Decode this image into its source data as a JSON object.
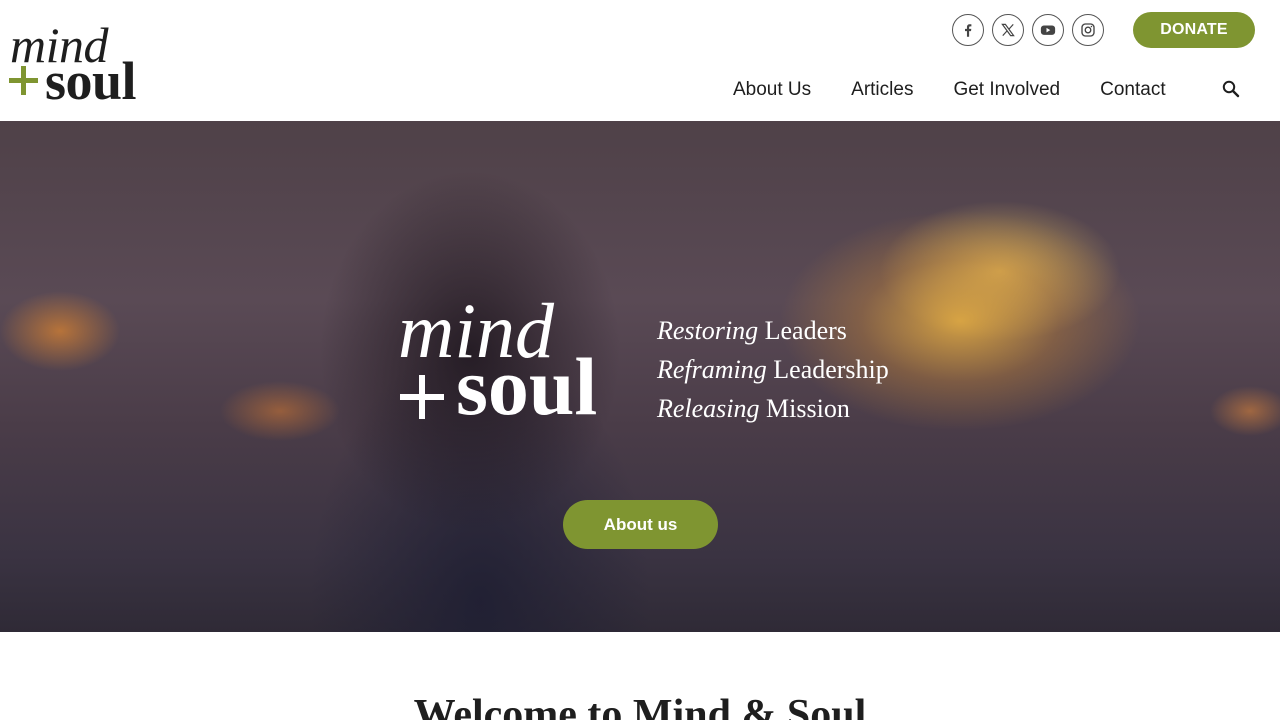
{
  "header": {
    "logo": {
      "line1": "mind",
      "plus": "+",
      "line2": "soul"
    },
    "socials": [
      {
        "name": "facebook",
        "icon": "facebook-icon"
      },
      {
        "name": "x",
        "icon": "x-icon"
      },
      {
        "name": "youtube",
        "icon": "youtube-icon"
      },
      {
        "name": "instagram",
        "icon": "instagram-icon"
      }
    ],
    "donate_label": "DONATE",
    "nav": [
      "About Us",
      "Articles",
      "Get Involved",
      "Contact"
    ],
    "search_icon": "search-icon"
  },
  "hero": {
    "logo": {
      "line1": "mind",
      "plus": "+",
      "line2": "soul"
    },
    "taglines": [
      {
        "em": "Restoring",
        "rest": " Leaders"
      },
      {
        "em": "Reframing",
        "rest": " Leadership"
      },
      {
        "em": "Releasing",
        "rest": " Mission"
      }
    ],
    "button_label": "About us"
  },
  "welcome_heading": "Welcome to Mind & Soul",
  "colors": {
    "accent": "#7f9531",
    "text": "#1e1e1e",
    "background": "#ffffff"
  }
}
